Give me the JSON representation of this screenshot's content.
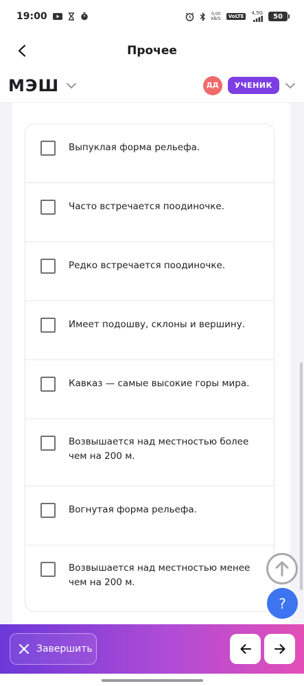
{
  "status_bar": {
    "time": "19:00",
    "net_speed_value": "0,00",
    "net_speed_unit": "KB/S",
    "volte": "VoLTE",
    "signal": "4,5G",
    "battery": "50"
  },
  "title_bar": {
    "title": "Прочее"
  },
  "header": {
    "brand": "МЭШ",
    "avatar_initials": "ДД",
    "role": "УЧЕНИК"
  },
  "options": [
    {
      "text": "Выпуклая форма рельефа.",
      "checked": false
    },
    {
      "text": "Часто встречается поодиночке.",
      "checked": false
    },
    {
      "text": "Редко встречается поодиночке.",
      "checked": false
    },
    {
      "text": "Имеет подошву, склоны и вершину.",
      "checked": false
    },
    {
      "text": "Кавказ — самые высокие горы мира.",
      "checked": false
    },
    {
      "text": "Возвышается над местностью более чем на 200 м.",
      "checked": false
    },
    {
      "text": "Вогнутая форма рельефа.",
      "checked": false
    },
    {
      "text": "Возвышается над местностью менее чем на 200 м.",
      "checked": false
    }
  ],
  "floating": {
    "help_label": "?"
  },
  "bottom_bar": {
    "finish_label": "Завершить"
  },
  "colors": {
    "accent": "#7b3fe4",
    "avatar": "#f06a6a",
    "help": "#3d74f0",
    "gradient_start": "#6b38d8",
    "gradient_end": "#e24fb7"
  },
  "icons": {
    "back": "chevron-left-icon",
    "dropdown": "chevron-down-icon",
    "scroll_top": "arrow-up-icon",
    "finish": "close-icon",
    "prev": "arrow-left-icon",
    "next": "arrow-right-icon"
  }
}
